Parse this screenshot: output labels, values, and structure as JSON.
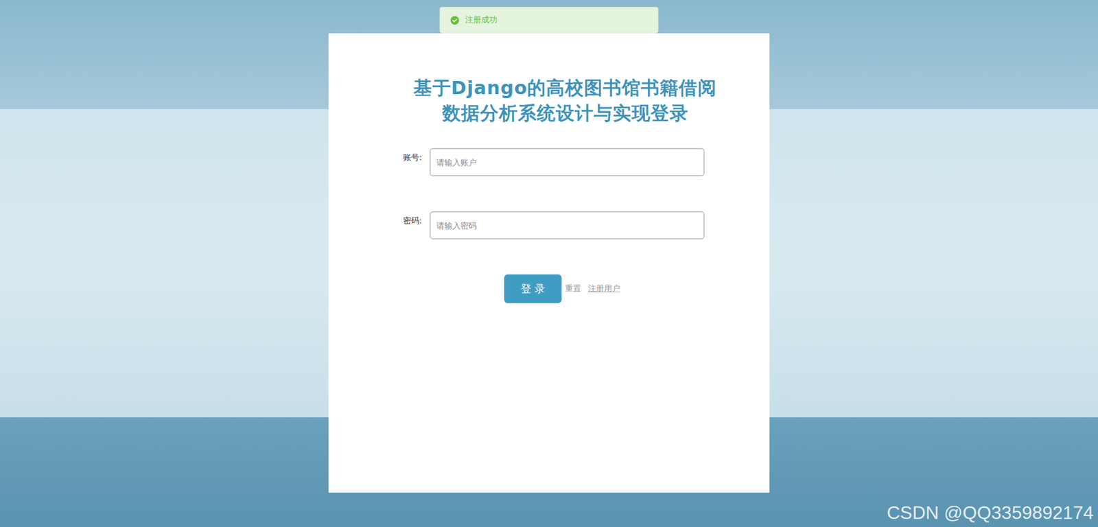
{
  "toast": {
    "text": "注册成功",
    "kind": "success"
  },
  "title_lines": [
    "基于Django的高校图书馆书籍借阅",
    "数据分析系统设计与实现登录"
  ],
  "fields": [
    {
      "label": "账号:",
      "placeholder": "请输入账户",
      "kind": "text"
    },
    {
      "label": "密码:",
      "placeholder": "请输入密码",
      "kind": "password"
    }
  ],
  "buttons": {
    "login": "登 录",
    "reset": "重置",
    "register": "注册用户"
  },
  "watermark": "CSDN @QQ3359892174"
}
